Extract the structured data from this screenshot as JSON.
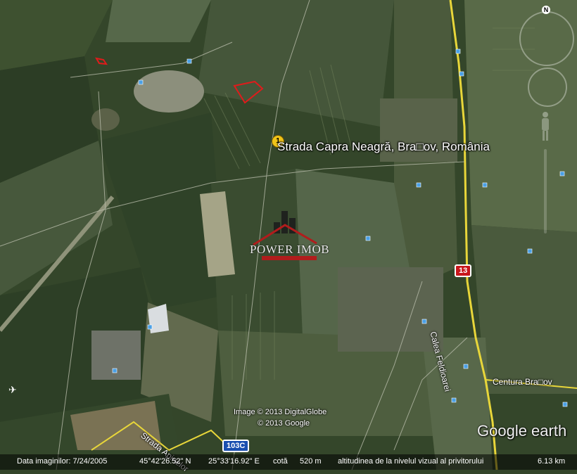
{
  "placemark": {
    "index_label": "1",
    "label": "Strada Capra Neagră, Bra□ov, România"
  },
  "watermark": {
    "brand": "POWER IMOB",
    "brand_color": "#b11c1c"
  },
  "copyright": {
    "line1": "Image © 2013 DigitalGlobe",
    "line2": "© 2013 Google"
  },
  "roads": {
    "road1_label": "Calea Feldioarei",
    "road2_label": "Centura Bra□ov",
    "road3_label": "Strada Apinelor",
    "shield_13": "13",
    "shield_103c": "103C"
  },
  "logo": {
    "text": "Google earth"
  },
  "navigation": {
    "north_label": "N"
  },
  "status_bar": {
    "date_label": "Data imaginilor: 7/24/2005",
    "latitude": "45°42'26.52\" N",
    "longitude": "25°33'16.92\" E",
    "elevation_label": "cotă",
    "elevation": "520 m",
    "eye_altitude_label": "altitudinea de la nivelul vizual al privitorului",
    "eye_altitude": "6.13 km"
  },
  "colors": {
    "field_dark": "#2e4226",
    "field_light": "#5f6d4c",
    "road_yellow": "#e8d63a",
    "parcel_outline": "#e01b1b"
  }
}
